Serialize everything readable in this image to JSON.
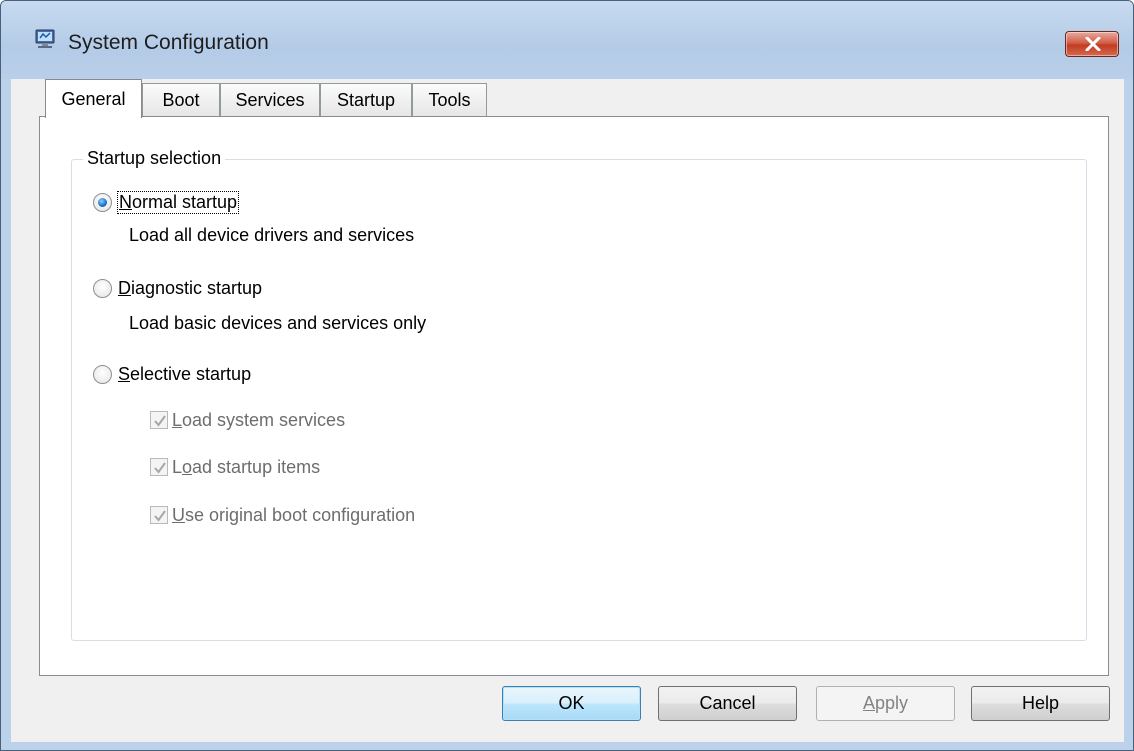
{
  "window": {
    "title": "System Configuration",
    "app_icon": "msconfig-computer-icon",
    "close_icon": "close-x-icon"
  },
  "tabs": [
    {
      "label": "General",
      "active": true
    },
    {
      "label": "Boot",
      "active": false
    },
    {
      "label": "Services",
      "active": false
    },
    {
      "label": "Startup",
      "active": false
    },
    {
      "label": "Tools",
      "active": false
    }
  ],
  "startup_selection": {
    "legend": "Startup selection",
    "selected": "normal",
    "normal": {
      "accesskey": "N",
      "rest": "ormal startup",
      "description": "Load all device drivers and services"
    },
    "diagnostic": {
      "accesskey": "D",
      "rest": "iagnostic startup",
      "description": "Load basic devices and services only"
    },
    "selective": {
      "accesskey": "S",
      "rest": "elective startup",
      "options": [
        {
          "accesskey": "L",
          "rest": "oad system services",
          "checked": true,
          "enabled": false
        },
        {
          "prefix": "L",
          "accesskey": "o",
          "rest": "ad startup items",
          "checked": true,
          "enabled": false
        },
        {
          "accesskey": "U",
          "rest": "se original boot configuration",
          "checked": true,
          "enabled": false
        }
      ]
    }
  },
  "buttons": {
    "ok": "OK",
    "cancel": "Cancel",
    "apply_accesskey": "A",
    "apply_rest": "pply",
    "help": "Help"
  },
  "colors": {
    "title_bar": "#bcd1ea",
    "close_button": "#c23c22",
    "radio_selected": "#1a6fc4",
    "default_button": "#3c7fb1"
  }
}
